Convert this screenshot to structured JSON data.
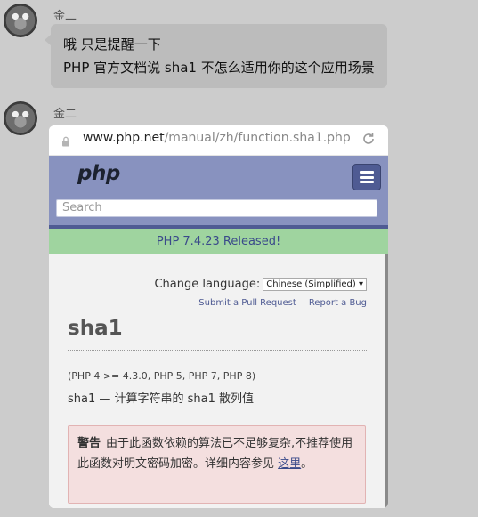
{
  "messages": [
    {
      "sender": "金二",
      "lines": [
        "哦 只是提醒一下",
        "PHP 官方文档说 sha1 不怎么适用你的这个应用场景"
      ]
    },
    {
      "sender": "金二"
    }
  ],
  "browser": {
    "url_host": "www.php.net",
    "url_path": "/manual/zh/function.sha1.php"
  },
  "php_page": {
    "logo": "php",
    "search_placeholder": "Search",
    "release_banner": "PHP 7.4.23 Released!",
    "change_language_label": "Change language:",
    "language_selected": "Chinese (Simplified)",
    "links": [
      "Submit a Pull Request",
      "Report a Bug"
    ],
    "title": "sha1",
    "versions": "(PHP 4 >= 4.3.0, PHP 5, PHP 7, PHP 8)",
    "description": "sha1 — 计算字符串的 sha1 散列值",
    "warning_label": "警告",
    "warning_text": "由于此函数依赖的算法已不足够复杂,不推荐使用此函数对明文密码加密。详细内容参见",
    "warning_link": "这里",
    "warning_end": "。"
  }
}
